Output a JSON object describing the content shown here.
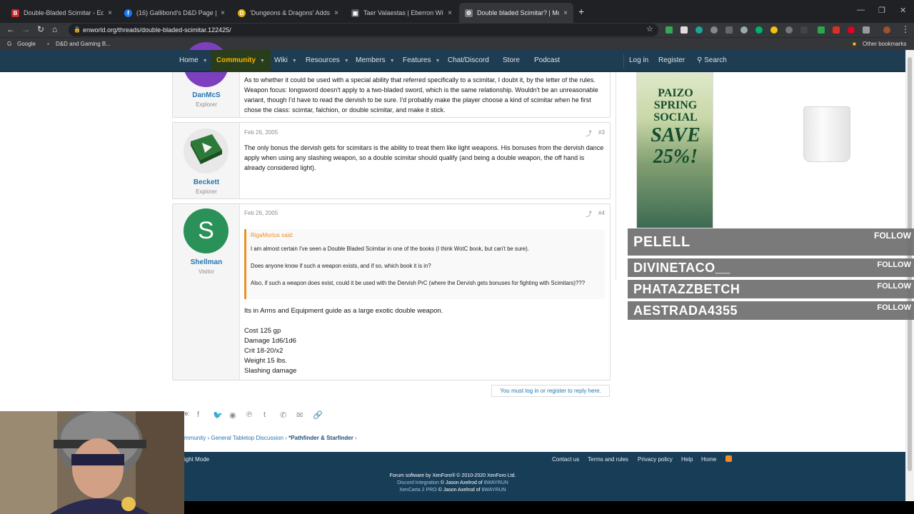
{
  "browser": {
    "tabs": [
      {
        "title": "Double-Bladed Scimitar - Equipm",
        "fav": "B",
        "color": "#c62828"
      },
      {
        "title": "(16) Gallibond's D&D Page | Face",
        "fav": "f",
        "color": "#1877f2"
      },
      {
        "title": "'Dungeons & Dragons' Adds Its",
        "fav": "D",
        "color": "#e0b000"
      },
      {
        "title": "Taer Valaestas | Eberron Wiki | Fa",
        "fav": "▣",
        "color": "#555"
      },
      {
        "title": "Double bladed Scimitar? | Morru",
        "fav": "⚙",
        "color": "#777"
      }
    ],
    "close_glyph": "×",
    "new_tab": "+",
    "url": "enworld.org/threads/double-bladed-scimitar.122425/",
    "bookmarks": [
      "Google",
      "D&D and Gaming B...",
      "Other bookmarks"
    ]
  },
  "nav": {
    "items": [
      "Home",
      "Community",
      "Wiki",
      "Resources",
      "Members",
      "Features",
      "Chat/Discord",
      "Store",
      "Podcast"
    ],
    "login": "Log in",
    "register": "Register",
    "search": "Search"
  },
  "posts": [
    {
      "user": "DanMcS",
      "title": "Explorer",
      "body": "As to whether it could be used with a special ability that referred specifically to a scimitar, I doubt it, by the letter of the rules. Weapon focus: longsword doesn't apply to a two-bladed sword, which is the same relationship. Wouldn't be an unreasonable variant, though I'd have to read the dervish to be sure. I'd probably make the player choose a kind of scimitar when he first chose the class: scimtar, falchion, or double scimitar, and make it stick."
    },
    {
      "user": "Beckett",
      "title": "Explorer",
      "date": "Feb 26, 2005",
      "num": "#3",
      "body": "The only bonus the dervish gets for scimitars is the ability to treat them like light weapons. His bonuses from the dervish dance apply when using any slashing weapon, so a double scimitar should qualify (and being a double weapon, the off hand is already considered light)."
    },
    {
      "user": "Shellman",
      "title": "Visitor",
      "initial": "S",
      "date": "Feb 26, 2005",
      "num": "#4",
      "quote_author": "RigaMortus said:",
      "quote": "I am almost certain I've seen a Double Bladed Scimitar in one of the books (I think WotC book, but can't be sure).\n\nDoes anyone know if such a weapon exists, and if so, which book it is in?\n\nAlso, if such a weapon does exist, could it be used with the Dervish PrC (where the Dervish gets bonuses for fighting with Scimitars)???",
      "body": "Its in Arms and Equipment guide as a large exotic double weapon.\n\nCost 125 gp\nDamage 1d6/1d6\nCrit 18-20/x2\nWeight 15 lbs.\nSlashing damage"
    }
  ],
  "reply_prompt": "You must log in or register to reply here.",
  "share_label": "re:",
  "breadcrumbs": [
    "mmunity",
    "General Tabletop Discussion",
    "*Pathfinder & Starfinder"
  ],
  "ad": {
    "line1": "PAIZO",
    "line2": "SPRING",
    "line3": "SOCIAL",
    "line4": "SAVE",
    "line5": "25%!"
  },
  "overlay": {
    "follow_label": "FOLLOW",
    "names": [
      "PELELL",
      "DIVINETACO__",
      "PHATAZZBETCH",
      "AESTRADA4355"
    ]
  },
  "footer": {
    "mode": "ight Mode",
    "links": [
      "Contact us",
      "Terms and rules",
      "Privacy policy",
      "Help",
      "Home"
    ],
    "credit1": "Forum software by XenForo® © 2010-2020 XenForo Ltd.",
    "credit2a": "Discord Integration",
    "credit2b": " © Jason Axelrod of ",
    "credit2c": "8WAYRUN",
    "credit3a": "XenCarta 2 PRO",
    "credit3b": " © Jason Axelrod of ",
    "credit3c": "8WAYRUN"
  }
}
